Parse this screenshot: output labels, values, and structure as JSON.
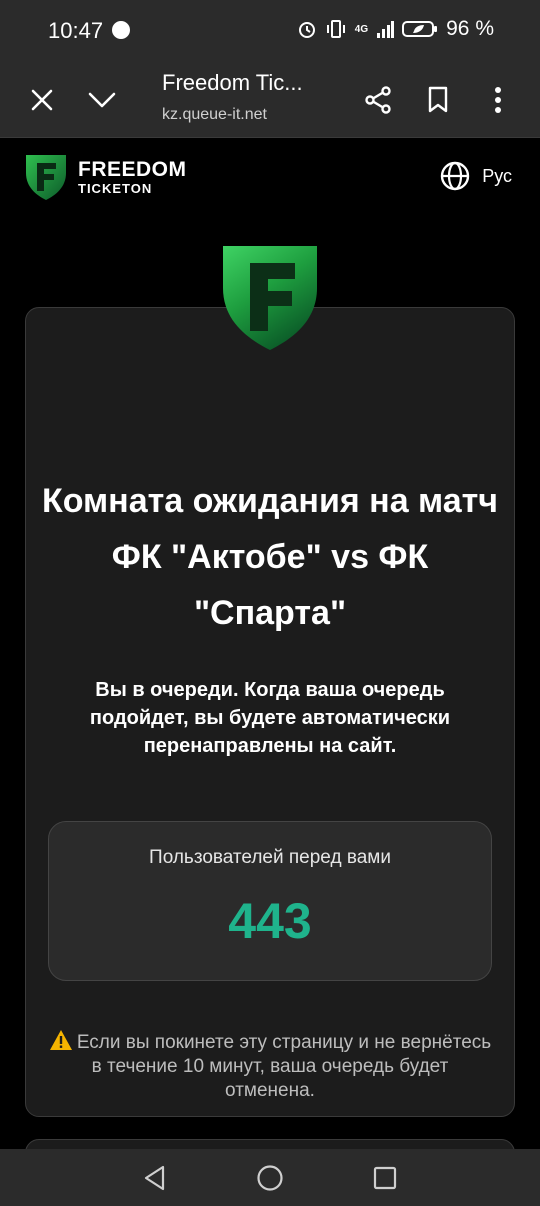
{
  "status_bar": {
    "time": "10:47",
    "battery_percent": "96 %",
    "network": "4G"
  },
  "browser": {
    "tab_title": "Freedom Tic...",
    "url": "kz.queue-it.net"
  },
  "header": {
    "brand_line1": "FREEDOM",
    "brand_line2": "TICKETON",
    "language": "Рус"
  },
  "main": {
    "heading": "Комната ожидания на матч ФК \"Актобе\" vs ФК \"Спарта\"",
    "subtext": "Вы в очереди. Когда ваша очередь подойдет, вы будете автоматически перенаправлены на сайт.",
    "queue_label": "Пользователей перед вами",
    "queue_count": "443",
    "warning": "Если вы покинете эту страницу и не вернётесь в течение 10 минут, ваша очередь будет отменена."
  },
  "colors": {
    "accent_green": "#1fb38c",
    "brand_green": "#1e9e3f",
    "card_bg": "#1c1c1c"
  },
  "icons": {
    "close": "close-icon",
    "collapse": "chevron-down-icon",
    "share": "share-icon",
    "bookmark": "bookmark-icon",
    "menu": "more-vert-icon",
    "language": "globe-icon",
    "warning": "warning-icon"
  }
}
